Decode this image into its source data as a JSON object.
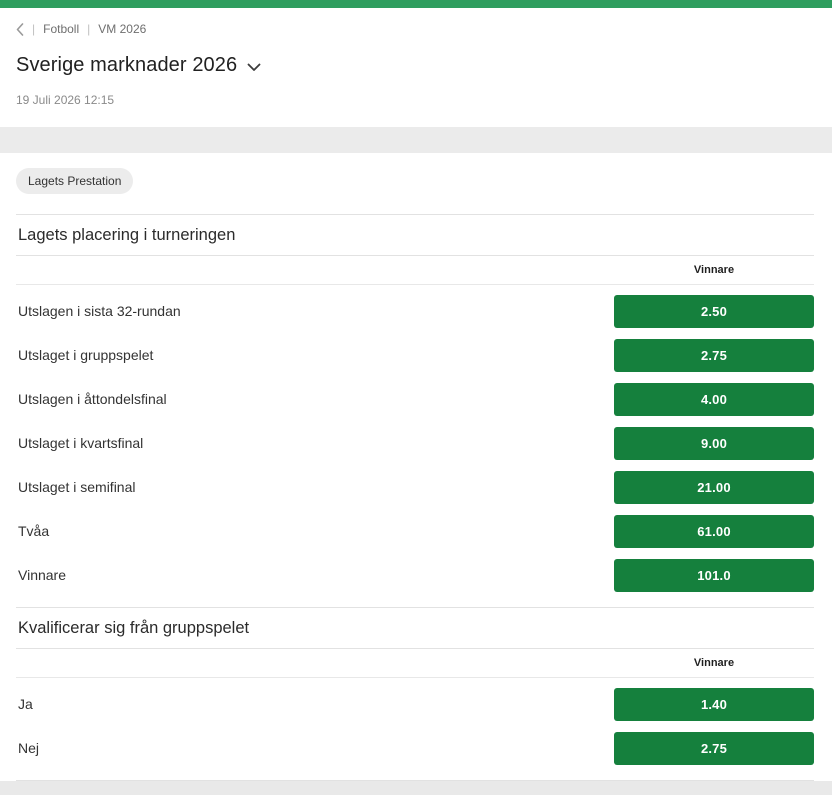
{
  "colors": {
    "accent": "#15803d",
    "top_bar": "#2f9e5f",
    "band": "#ebebeb"
  },
  "icons": {
    "back": "chevron-left",
    "title_expand": "chevron-down"
  },
  "header": {
    "separator": "|",
    "breadcrumb": [
      "Fotboll",
      "VM 2026"
    ],
    "title": "Sverige marknader 2026",
    "datetime": "19 Juli 2026 12:15"
  },
  "tabs": [
    {
      "label": "Lagets Prestation"
    }
  ],
  "sections": [
    {
      "title": "Lagets placering i turneringen",
      "column_header": "Vinnare",
      "rows": [
        {
          "label": "Utslagen i sista 32-rundan",
          "odds": "2.50"
        },
        {
          "label": "Utslaget i gruppspelet",
          "odds": "2.75"
        },
        {
          "label": "Utslagen i åttondelsfinal",
          "odds": "4.00"
        },
        {
          "label": "Utslaget i kvartsfinal",
          "odds": "9.00"
        },
        {
          "label": "Utslaget i semifinal",
          "odds": "21.00"
        },
        {
          "label": "Tvåa",
          "odds": "61.00"
        },
        {
          "label": "Vinnare",
          "odds": "101.0"
        }
      ]
    },
    {
      "title": "Kvalificerar sig från gruppspelet",
      "column_header": "Vinnare",
      "rows": [
        {
          "label": "Ja",
          "odds": "1.40"
        },
        {
          "label": "Nej",
          "odds": "2.75"
        }
      ]
    }
  ]
}
